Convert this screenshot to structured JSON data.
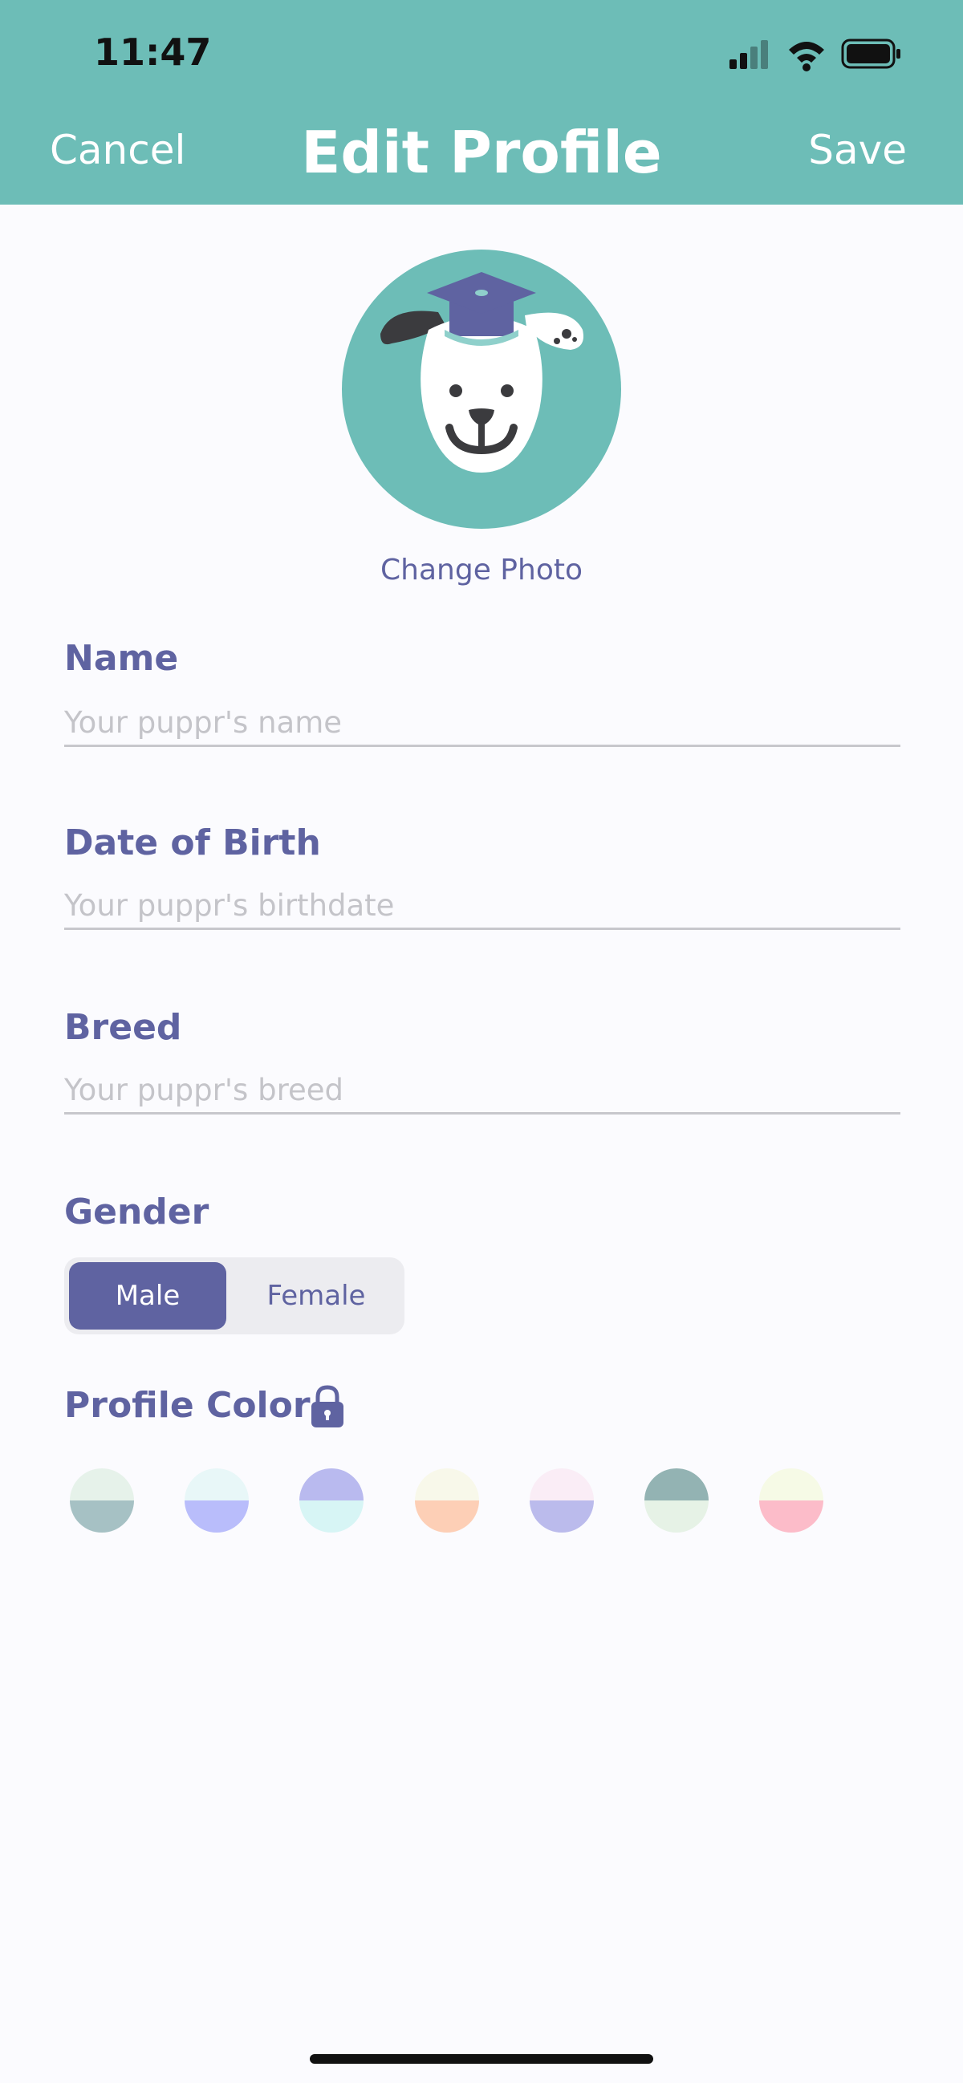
{
  "status_bar": {
    "time": "11:47"
  },
  "nav": {
    "cancel": "Cancel",
    "title": "Edit Profile",
    "save": "Save"
  },
  "avatar": {
    "change_photo": "Change Photo"
  },
  "form": {
    "name": {
      "label": "Name",
      "placeholder": "Your puppr's name"
    },
    "dob": {
      "label": "Date of Birth",
      "placeholder": "Your puppr's birthdate"
    },
    "breed": {
      "label": "Breed",
      "placeholder": "Your puppr's breed"
    },
    "gender": {
      "label": "Gender",
      "options": [
        "Male",
        "Female"
      ],
      "selected": "Male"
    },
    "profile_color": {
      "label": "Profile Color",
      "locked": true,
      "swatches": [
        {
          "top": "#e6f2ea",
          "bottom": "#a6c1c4"
        },
        {
          "top": "#e8f7f8",
          "bottom": "#b9bdfb"
        },
        {
          "top": "#b9baef",
          "bottom": "#d7f5f5"
        },
        {
          "top": "#f8f8ea",
          "bottom": "#fdcfb6"
        },
        {
          "top": "#faedf6",
          "bottom": "#bbbbec"
        },
        {
          "top": "#93b3b3",
          "bottom": "#e6f2e6"
        },
        {
          "top": "#f6fae6",
          "bottom": "#fcbcc9"
        }
      ]
    }
  },
  "colors": {
    "header": "#6dbdb7",
    "accent": "#5f63a1"
  }
}
